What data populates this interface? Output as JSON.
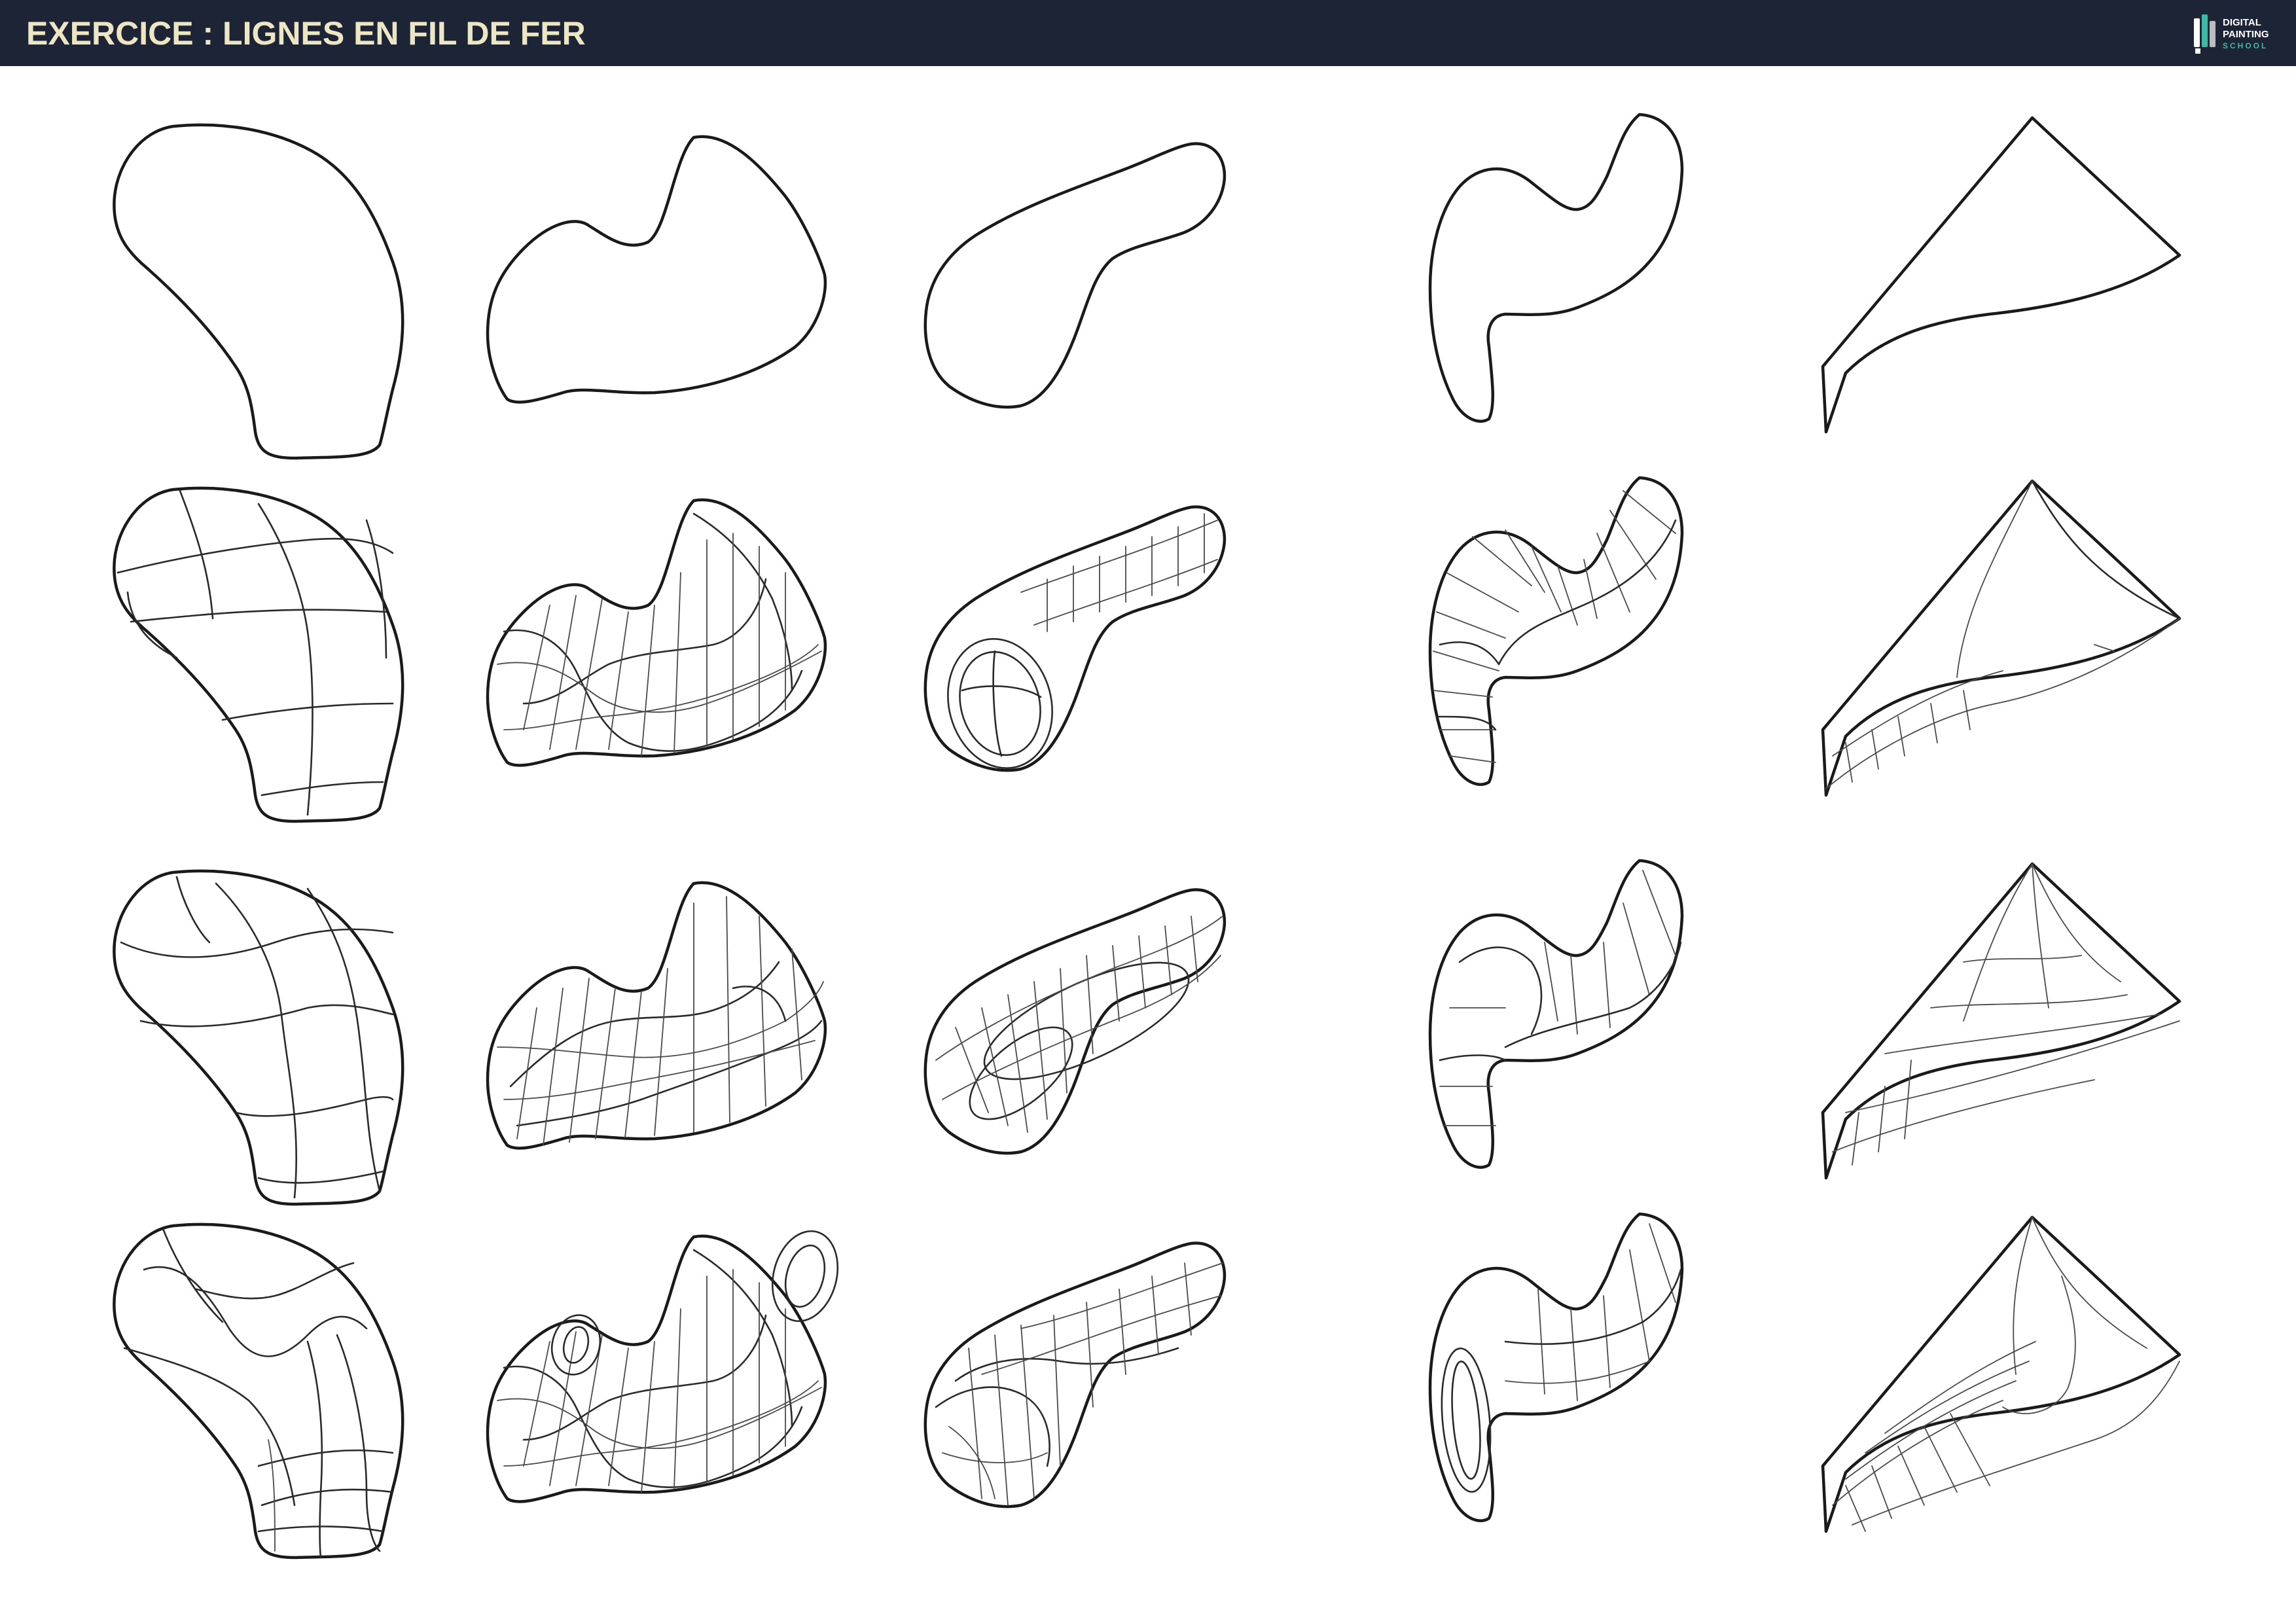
{
  "header": {
    "title": "EXERCICE : LIGNES EN FIL DE FER",
    "background_color": "#1c2435",
    "title_color": "#ede6c4"
  },
  "logo": {
    "line1": "DIGITAL",
    "line2": "PAINTING",
    "line3": "SCHOOL",
    "accent_color": "#3fb8a6"
  },
  "grid": {
    "columns": 5,
    "rows": 4,
    "shapes": [
      "blob",
      "peanut",
      "bean",
      "s-curve",
      "triangle-fin"
    ],
    "rows_description_hidden": true
  }
}
